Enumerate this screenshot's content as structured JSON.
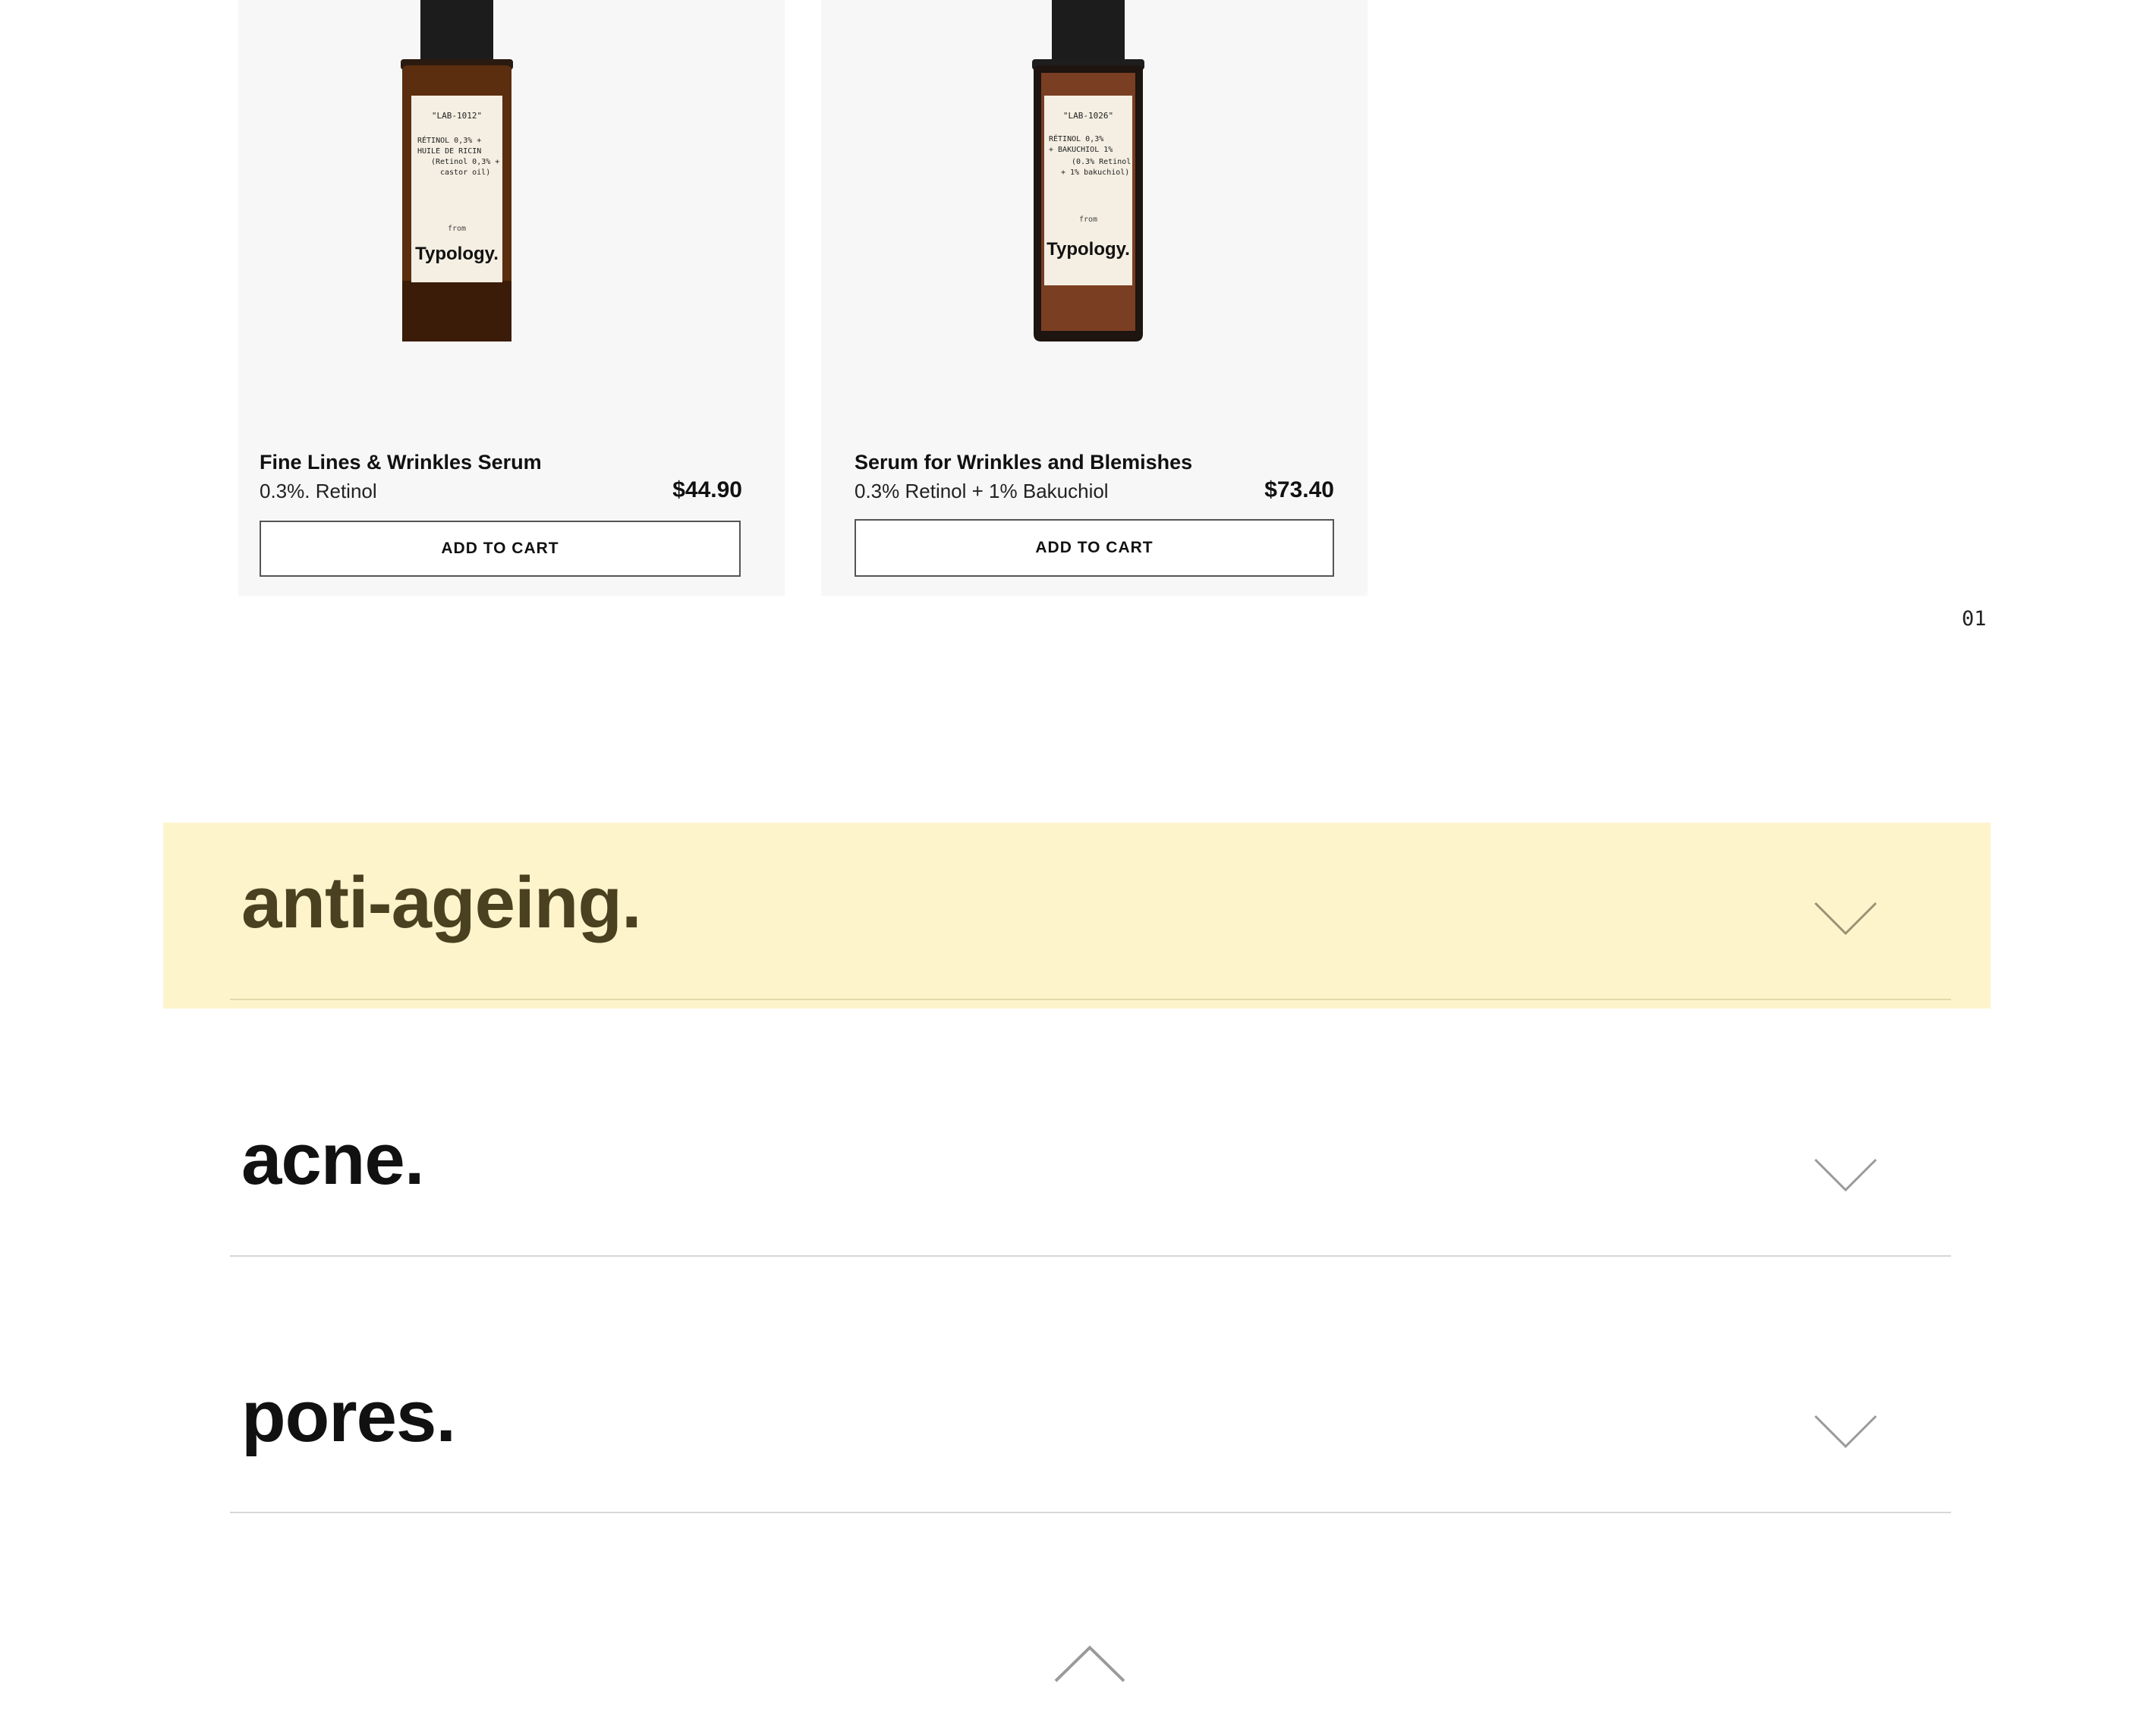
{
  "products": [
    {
      "label_code": "\"LAB-1012\"",
      "label_lines": [
        "RÉTINOL 0,3% +",
        "HUILE DE RICIN",
        "(Retinol 0,3% +",
        "castor oil)"
      ],
      "label_from": "from",
      "label_brand": "Typology.",
      "name": "Fine Lines & Wrinkles Serum",
      "subtitle": "0.3%. Retinol",
      "price": "$44.90",
      "cta": "ADD TO CART"
    },
    {
      "label_code": "\"LAB-1026\"",
      "label_lines": [
        "RÉTINOL 0,3%",
        "+ BAKUCHIOL 1%",
        "(0.3% Retinol",
        "+ 1% bakuchiol)"
      ],
      "label_from": "from",
      "label_brand": "Typology.",
      "name": "Serum for Wrinkles and Blemishes",
      "subtitle": "0.3% Retinol + 1% Bakuchiol",
      "price": "$73.40",
      "cta": "ADD TO CART"
    }
  ],
  "pagination": {
    "current": "01"
  },
  "accordion": [
    {
      "title": "anti-ageing.",
      "active": true
    },
    {
      "title": "acne.",
      "active": false
    },
    {
      "title": "pores.",
      "active": false
    }
  ],
  "colors": {
    "active_bg": "#fef4cc",
    "active_text": "#4a4120",
    "bottle_glass": "#5a2e0e",
    "card_bg": "#f7f7f7"
  },
  "icons": {
    "accordion_toggle": "chevron-down-icon",
    "back_to_top": "chevron-up-icon"
  }
}
